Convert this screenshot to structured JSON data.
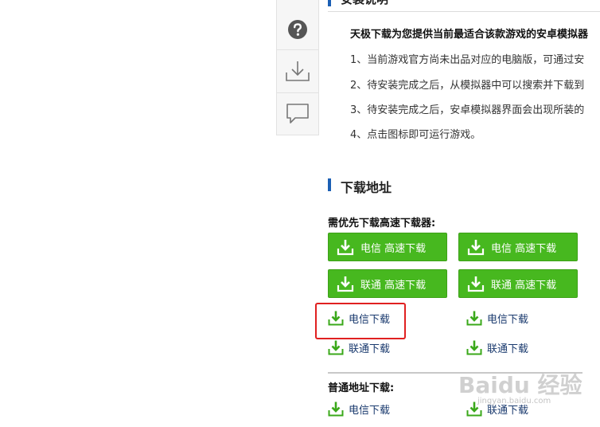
{
  "toolbar": {
    "items": [
      {
        "icon": "help-icon"
      },
      {
        "icon": "download-icon"
      },
      {
        "icon": "comment-icon"
      }
    ]
  },
  "guide": {
    "heading": "安装说明",
    "intro": "天极下载为您提供当前最适合该款游戏的安卓模拟器",
    "steps": [
      "1、当前游戏官方尚未出品对应的电脑版，可通过安",
      "2、待安装完成之后，从模拟器中可以搜索并下载到",
      "3、待安装完成之后，安卓模拟器界面会出现所装的",
      "4、点击图标即可运行游戏。"
    ]
  },
  "download": {
    "title": "下载地址",
    "fast_label": "需优先下载高速下载器:",
    "fast_buttons": [
      {
        "label": "电信 高速下载"
      },
      {
        "label": "电信 高速下载"
      },
      {
        "label": "联通 高速下载"
      },
      {
        "label": "联通 高速下载"
      }
    ],
    "links": [
      {
        "label": "电信下载"
      },
      {
        "label": "电信下载"
      },
      {
        "label": "联通下载"
      },
      {
        "label": "联通下载"
      }
    ],
    "normal_label": "普通地址下载:",
    "normal_links": [
      {
        "label": "电信下载"
      },
      {
        "label": "联通下载"
      }
    ]
  },
  "watermark": {
    "text": "Baidu 经验",
    "sub": "jingyan.baidu.com"
  },
  "colors": {
    "accent_blue": "#1b5fb4",
    "button_green": "#47b81f",
    "highlight_red": "#e02020"
  }
}
